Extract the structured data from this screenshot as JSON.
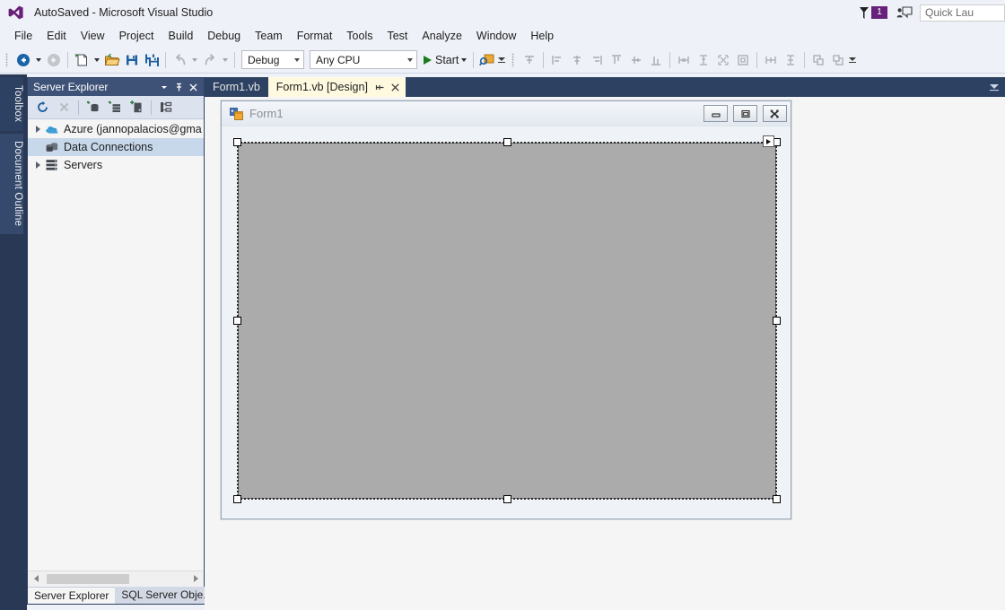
{
  "window": {
    "title": "AutoSaved - Microsoft Visual Studio",
    "logo_icon": "visual-studio-logo-icon",
    "accent_purple": "#68217a",
    "titlebar_bg": "#eef1f7"
  },
  "title_right": {
    "notification_icon": "notification-flag-icon",
    "notification_count": "1",
    "feedback_icon": "send-feedback-icon",
    "quick_launch_placeholder": "Quick Lau"
  },
  "menu": {
    "items": [
      {
        "label": "File"
      },
      {
        "label": "Edit"
      },
      {
        "label": "View"
      },
      {
        "label": "Project"
      },
      {
        "label": "Build"
      },
      {
        "label": "Debug"
      },
      {
        "label": "Team"
      },
      {
        "label": "Format"
      },
      {
        "label": "Tools"
      },
      {
        "label": "Test"
      },
      {
        "label": "Analyze"
      },
      {
        "label": "Window"
      },
      {
        "label": "Help"
      }
    ]
  },
  "toolbar": {
    "navigate_back_icon": "navigate-back-icon",
    "navigate_forward_icon": "navigate-forward-icon",
    "new_project_icon": "new-project-icon",
    "open_file_icon": "open-file-icon",
    "save_icon": "save-icon",
    "save_all_icon": "save-all-icon",
    "undo_icon": "undo-icon",
    "redo_icon": "redo-icon",
    "configuration_value": "Debug",
    "platform_value": "Any CPU",
    "start_label": "Start",
    "start_icon": "play-icon",
    "find_icon": "find-in-files-icon",
    "layout_icons": [
      "align-lefts-icon",
      "align-centers-icon",
      "align-rights-icon",
      "align-tops-icon",
      "align-middles-icon",
      "align-bottoms-icon",
      "make-same-width-icon",
      "make-same-height-icon",
      "make-same-size-icon",
      "size-to-grid-icon",
      "horizontal-spacing-icon",
      "vertical-spacing-icon",
      "bring-to-front-icon",
      "send-to-back-icon"
    ]
  },
  "left_dock": {
    "tabs": [
      {
        "label": "Toolbox",
        "name": "toolbox"
      },
      {
        "label": "Document Outline",
        "name": "document-outline"
      }
    ]
  },
  "server_explorer": {
    "title": "Server Explorer",
    "header_icons": {
      "dropdown": "chevron-down-icon",
      "pin": "pin-icon",
      "close": "close-icon"
    },
    "toolbar_icons": [
      "refresh-icon",
      "stop-icon",
      "connect-to-database-icon",
      "connect-to-server-icon",
      "add-server-icon",
      "object-relationship-icon"
    ],
    "tree": [
      {
        "label": "Azure (jannopalacios@gma",
        "icon": "azure-cloud-icon",
        "expandable": true,
        "selected": false,
        "indent": 0
      },
      {
        "label": "Data Connections",
        "icon": "data-connections-icon",
        "expandable": false,
        "selected": true,
        "indent": 0
      },
      {
        "label": "Servers",
        "icon": "servers-icon",
        "expandable": true,
        "selected": false,
        "indent": 0
      }
    ],
    "scrollbar": {
      "left_arrow_icon": "scroll-left-icon",
      "right_arrow_icon": "scroll-right-icon"
    },
    "bottom_tabs": [
      {
        "label": "Server Explorer",
        "active": true
      },
      {
        "label": "SQL Server Obje...",
        "active": false
      }
    ]
  },
  "document_tabs": {
    "tabs": [
      {
        "label": "Form1.vb",
        "active": false
      },
      {
        "label": "Form1.vb [Design]",
        "active": true,
        "pin_icon": "pin-icon",
        "close_icon": "close-icon"
      }
    ],
    "overflow_icon": "tab-overflow-icon"
  },
  "designer": {
    "form": {
      "icon": "windows-form-icon",
      "title": "Form1",
      "minimize_icon": "minimize-icon",
      "maximize_icon": "maximize-icon",
      "close_icon": "close-icon",
      "body_color": "#ababab",
      "selected": true,
      "smart_tag_icon": "smart-tag-icon"
    }
  }
}
